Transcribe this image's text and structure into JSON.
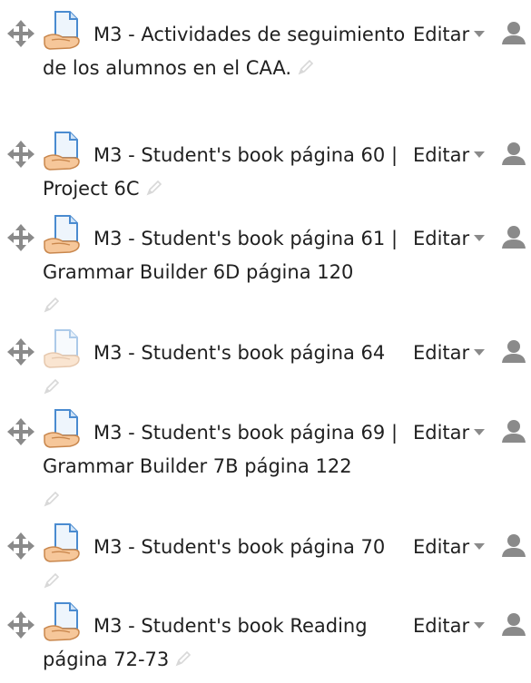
{
  "activities": [
    {
      "title": "M3 - Actividades de seguimiento de los alumnos en el CAA.",
      "edit_label": "Editar",
      "icon": "resource-file-icon",
      "dimmed": false
    },
    {
      "title": "M3 - Student's book página 60 | Project 6C",
      "edit_label": "Editar",
      "icon": "resource-file-icon",
      "dimmed": false
    },
    {
      "title": "M3 - Student's book página 61 | Grammar Builder 6D página 120",
      "edit_label": "Editar",
      "icon": "resource-file-icon",
      "dimmed": false
    },
    {
      "title": "M3 - Student's book página 64",
      "edit_label": "Editar",
      "icon": "resource-file-icon",
      "dimmed": true
    },
    {
      "title": "M3 - Student's book página 69 | Grammar Builder 7B página 122",
      "edit_label": "Editar",
      "icon": "resource-file-icon",
      "dimmed": false
    },
    {
      "title": "M3 - Student's book página 70",
      "edit_label": "Editar",
      "icon": "resource-file-icon",
      "dimmed": false
    },
    {
      "title": "M3 - Student's book Reading página 72-73",
      "edit_label": "Editar",
      "icon": "resource-file-icon",
      "dimmed": false
    }
  ],
  "icons": {
    "move": "move-icon",
    "edit_title": "pencil-icon",
    "assign": "user-icon"
  },
  "colors": {
    "text": "#1f1f1f",
    "icon_gray": "#8a8a8a",
    "pencil_gray": "#d8d8d8"
  }
}
